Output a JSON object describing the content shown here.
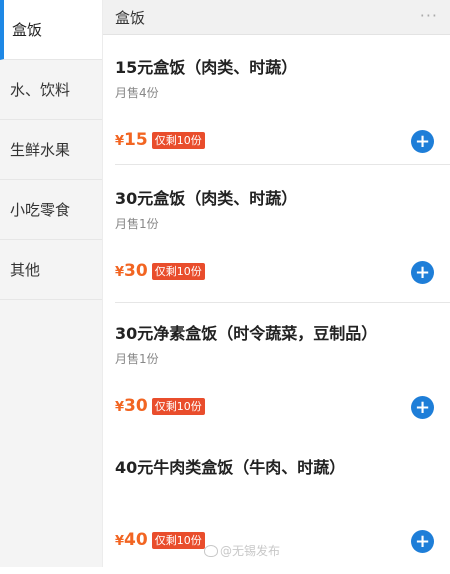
{
  "sidebar": {
    "categories": [
      {
        "label": "盒饭",
        "active": true
      },
      {
        "label": "水、饮料",
        "active": false
      },
      {
        "label": "生鲜水果",
        "active": false
      },
      {
        "label": "小吃零食",
        "active": false
      },
      {
        "label": "其他",
        "active": false
      }
    ]
  },
  "section": {
    "title": "盒饭",
    "more_label": "···"
  },
  "items": [
    {
      "name": "15元盒饭（肉类、时蔬）",
      "sales": "月售4份",
      "currency": "¥",
      "price": "15",
      "stock": "仅剩10份",
      "add_label": "+"
    },
    {
      "name": "30元盒饭（肉类、时蔬）",
      "sales": "月售1份",
      "currency": "¥",
      "price": "30",
      "stock": "仅剩10份",
      "add_label": "+"
    },
    {
      "name": "30元净素盒饭（时令蔬菜，豆制品）",
      "sales": "月售1份",
      "currency": "¥",
      "price": "30",
      "stock": "仅剩10份",
      "add_label": "+"
    },
    {
      "name": "40元牛肉类盒饭（牛肉、时蔬）",
      "sales": "",
      "currency": "¥",
      "price": "40",
      "stock": "仅剩10份",
      "add_label": "+"
    }
  ],
  "watermark": {
    "text": "@无锡发布"
  },
  "colors": {
    "accent": "#1e7ed8",
    "price": "#f26522",
    "stock_badge": "#e94d2c"
  }
}
